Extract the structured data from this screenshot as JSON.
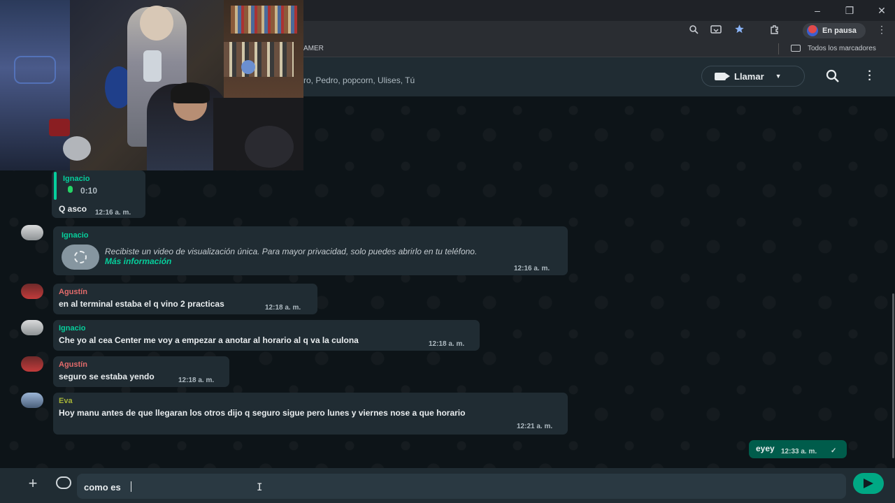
{
  "browser": {
    "profile_status": "En pausa",
    "bookmark_partial": "AMER",
    "all_bookmarks": "Todos los marcadores",
    "window_controls": {
      "minimize": "–",
      "restore": "❐",
      "close": "✕"
    }
  },
  "chat_header": {
    "participants": "ro, Pedro, popcorn, Ulises, Tú",
    "call_label": "Llamar"
  },
  "messages": [
    {
      "sender": "Ignacio",
      "sender_color": "#06cf9c",
      "quoted_audio": "0:10",
      "text": "Q asco",
      "time": "12:16 a. m."
    },
    {
      "sender": "Ignacio",
      "sender_color": "#06cf9c",
      "text": "Recibiste un video de visualización única. Para mayor privacidad, solo puedes abrirlo en tu teléfono.",
      "link": "Más información",
      "time": "12:16 a. m."
    },
    {
      "sender": "Agustín",
      "sender_color": "#e26b6b",
      "text": "en al terminal estaba el q vino 2 practicas",
      "time": "12:18 a. m."
    },
    {
      "sender": "Ignacio",
      "sender_color": "#06cf9c",
      "text": "Che yo al cea Center me voy a empezar a anotar al horario al q va la culona",
      "time": "12:18 a. m."
    },
    {
      "sender": "Agustín",
      "sender_color": "#e26b6b",
      "text": "seguro se estaba yendo",
      "time": "12:18 a. m."
    },
    {
      "sender": "Eva",
      "sender_color": "#a5b337",
      "text": "Hoy manu antes de que llegaran los otros dijo q seguro sigue pero lunes y viernes nose a que horario",
      "time": "12:21 a. m."
    },
    {
      "sender": "",
      "text": "eyey",
      "time": "12:33 a. m.",
      "status": "✓"
    }
  ],
  "composer": {
    "value": "como es",
    "plus": "+",
    "ibeam": "I"
  },
  "colors": {
    "accent": "#00a884",
    "outgoing": "#005c4b",
    "incoming": "#202c33"
  }
}
